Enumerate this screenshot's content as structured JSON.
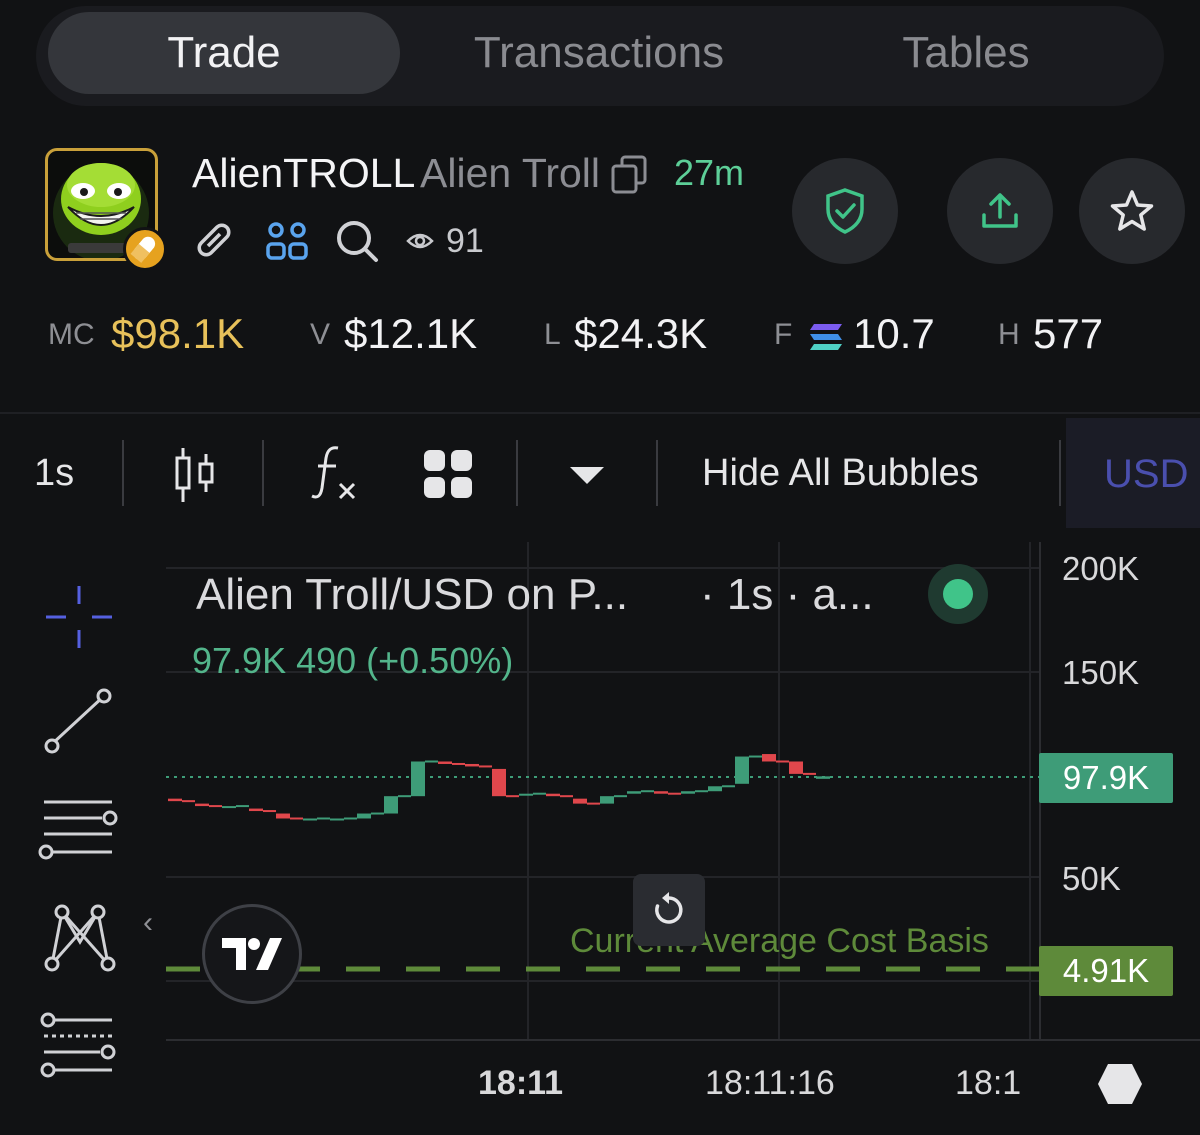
{
  "tabs": [
    {
      "label": "Trade",
      "active": true
    },
    {
      "label": "Transactions",
      "active": false
    },
    {
      "label": "Tables",
      "active": false
    }
  ],
  "token": {
    "symbol": "AlienTROLL",
    "name": "Alien Troll",
    "age": "27m",
    "watchers": "91"
  },
  "stats": {
    "mc_label": "MC",
    "mc_value": "$98.1K",
    "v_label": "V",
    "v_value": "$12.1K",
    "l_label": "L",
    "l_value": "$24.3K",
    "f_label": "F",
    "f_value": "10.7",
    "h_label": "H",
    "h_value": "577"
  },
  "toolbar": {
    "interval": "1s",
    "hide_bubbles": "Hide All Bubbles",
    "currency": "USD"
  },
  "chart": {
    "legend_title": "Alien Troll/USD on P...",
    "legend_extra": "· 1s · a...",
    "legend_values": "97.9K  490 (+0.50%)",
    "price_axis": [
      "200K",
      "150K",
      "50K"
    ],
    "current_price_tag": "97.9K",
    "cost_basis_tag": "4.91K",
    "cost_basis_label": "Current Average Cost Basis",
    "time_axis": [
      "18:11",
      "18:11:16",
      "18:1"
    ]
  },
  "colors": {
    "up": "#3e9c78",
    "down": "#e0474c",
    "cost_basis": "#5e8a3a",
    "age_green": "#5dcf98",
    "mc_gold": "#e8c15a",
    "usd_blue": "#4a4fae"
  },
  "chart_data": {
    "type": "candlestick",
    "title": "Alien Troll/USD on P...",
    "ylim": [
      0,
      200000
    ],
    "y_ticks": [
      "200K",
      "150K",
      "50K"
    ],
    "x_ticks": [
      "18:11",
      "18:11:16",
      "18:1"
    ],
    "last_price": 97900,
    "change": 490,
    "change_pct": 0.5,
    "cost_basis": 4910,
    "candles": [
      {
        "o": 97100,
        "c": 97000,
        "dir": "down"
      },
      {
        "o": 96900,
        "c": 96800,
        "dir": "down"
      },
      {
        "o": 96800,
        "c": 96800,
        "dir": "up"
      },
      {
        "o": 96700,
        "c": 96600,
        "dir": "down"
      },
      {
        "o": 96500,
        "c": 96300,
        "dir": "down"
      },
      {
        "o": 96300,
        "c": 96300,
        "dir": "up"
      },
      {
        "o": 96300,
        "c": 96300,
        "dir": "up"
      },
      {
        "o": 96300,
        "c": 96500,
        "dir": "up"
      },
      {
        "o": 96500,
        "c": 97200,
        "dir": "up"
      },
      {
        "o": 97200,
        "c": 98600,
        "dir": "up"
      },
      {
        "o": 98600,
        "c": 98500,
        "dir": "down"
      },
      {
        "o": 98500,
        "c": 98400,
        "dir": "down"
      },
      {
        "o": 98300,
        "c": 97200,
        "dir": "down"
      },
      {
        "o": 97300,
        "c": 97300,
        "dir": "up"
      },
      {
        "o": 97300,
        "c": 97200,
        "dir": "down"
      },
      {
        "o": 97100,
        "c": 96900,
        "dir": "down"
      },
      {
        "o": 96900,
        "c": 97200,
        "dir": "up"
      },
      {
        "o": 97300,
        "c": 97400,
        "dir": "up"
      },
      {
        "o": 97400,
        "c": 97300,
        "dir": "down"
      },
      {
        "o": 97300,
        "c": 97400,
        "dir": "up"
      },
      {
        "o": 97400,
        "c": 97600,
        "dir": "up"
      },
      {
        "o": 97700,
        "c": 98800,
        "dir": "up"
      },
      {
        "o": 98900,
        "c": 98600,
        "dir": "down"
      },
      {
        "o": 98600,
        "c": 98100,
        "dir": "down"
      },
      {
        "o": 98000,
        "c": 97900,
        "dir": "up"
      }
    ]
  }
}
